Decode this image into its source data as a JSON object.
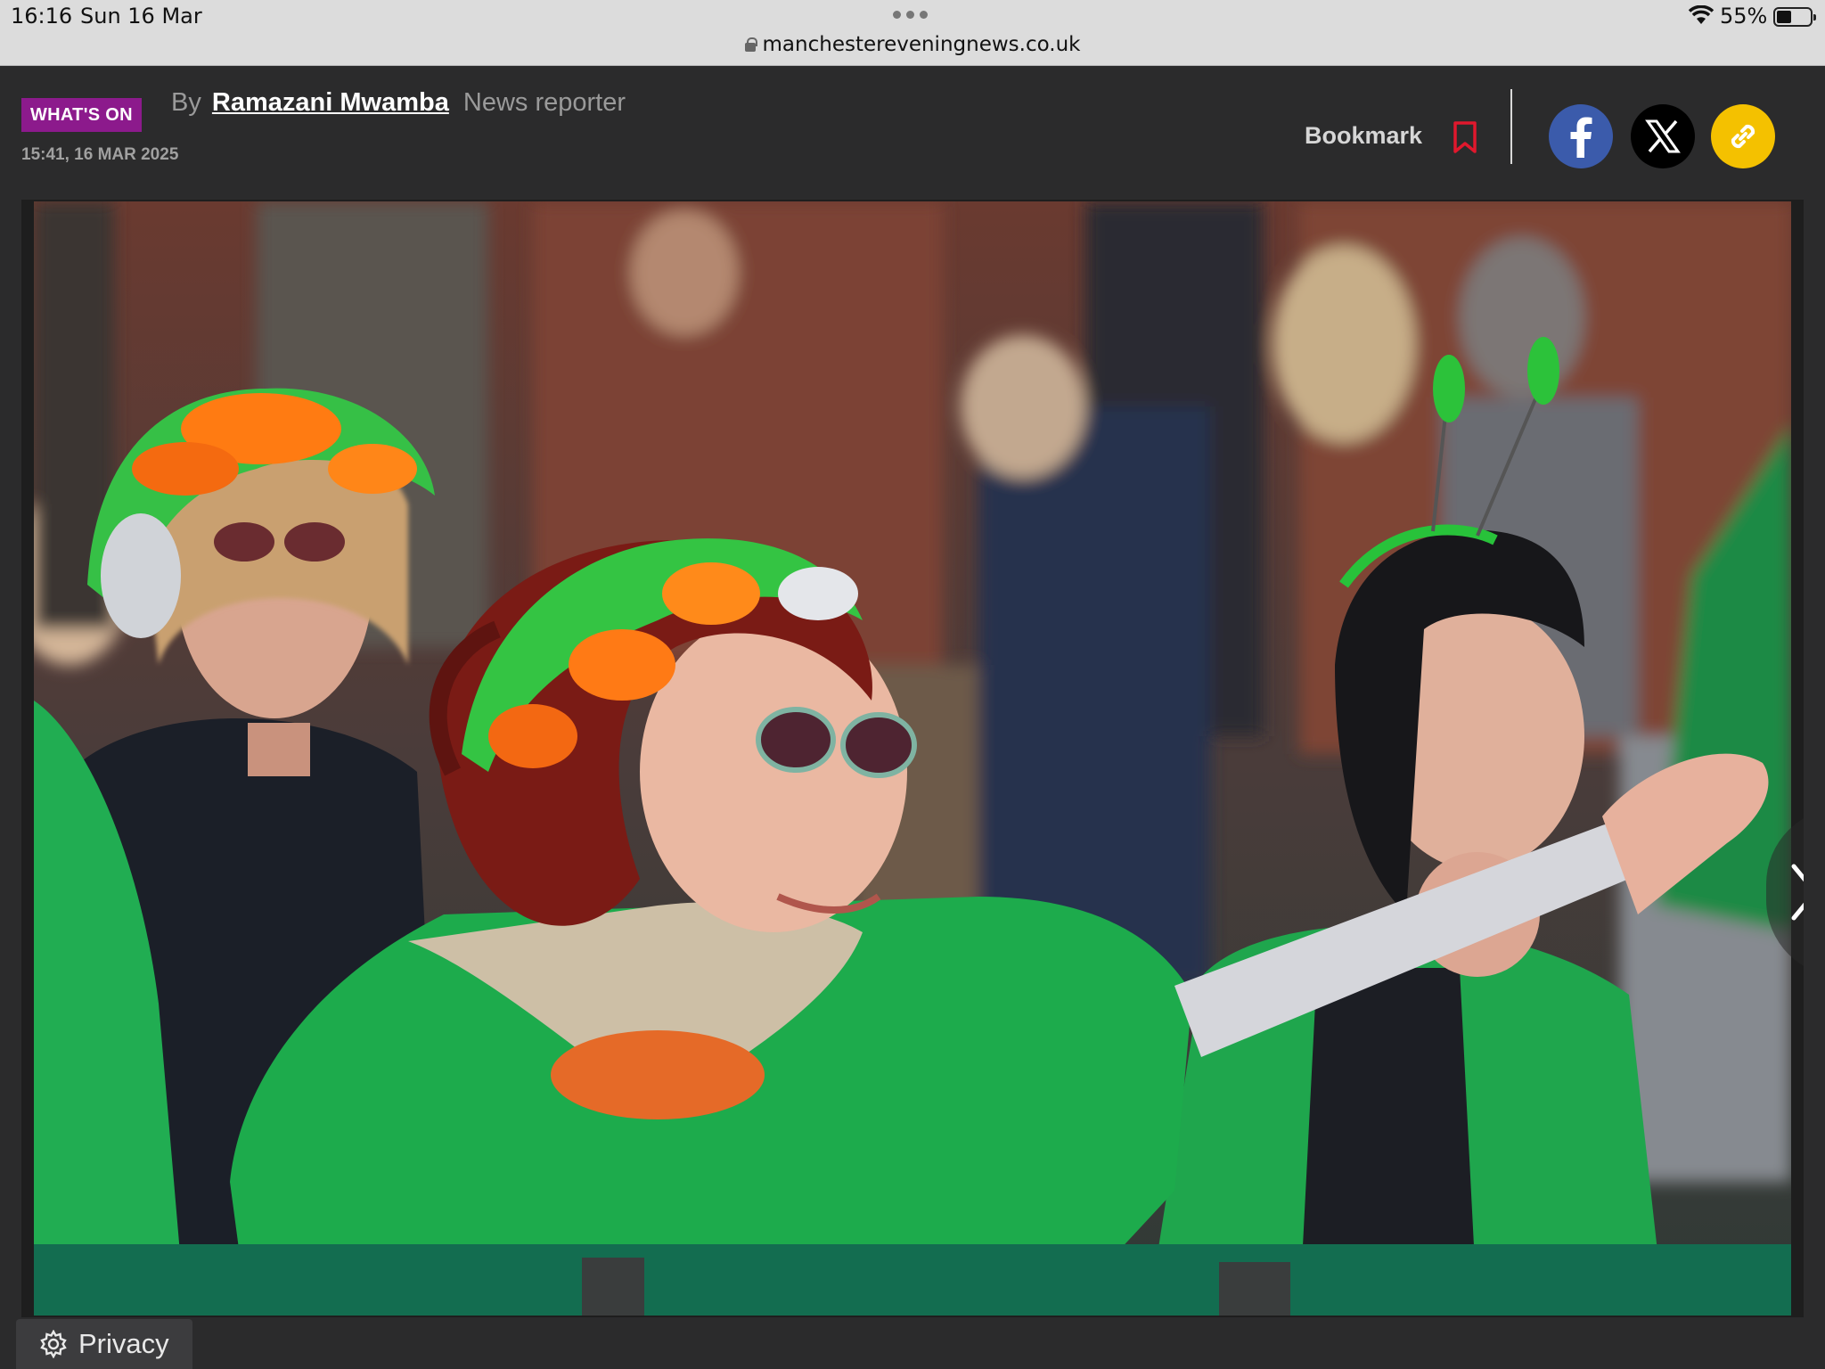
{
  "status_bar": {
    "time": "16:16",
    "date": "Sun 16 Mar",
    "battery": "55%",
    "battery_level": 0.55
  },
  "browser": {
    "url": "manchestereveningnews.co.uk"
  },
  "article": {
    "category": "WHAT'S ON",
    "by_prefix": "By",
    "author": "Ramazani Mwamba",
    "author_role": "News reporter",
    "timestamp": "15:41, 16 MAR 2025"
  },
  "actions": {
    "bookmark_label": "Bookmark"
  },
  "social_icons": [
    "facebook-icon",
    "x-icon",
    "link-icon"
  ],
  "footer": {
    "privacy_label": "Privacy"
  },
  "colors": {
    "category_bg": "#8c1a8c",
    "facebook": "#3b5bab",
    "x": "#000000",
    "link": "#f4c100",
    "bookmark_icon": "#e0182d"
  }
}
